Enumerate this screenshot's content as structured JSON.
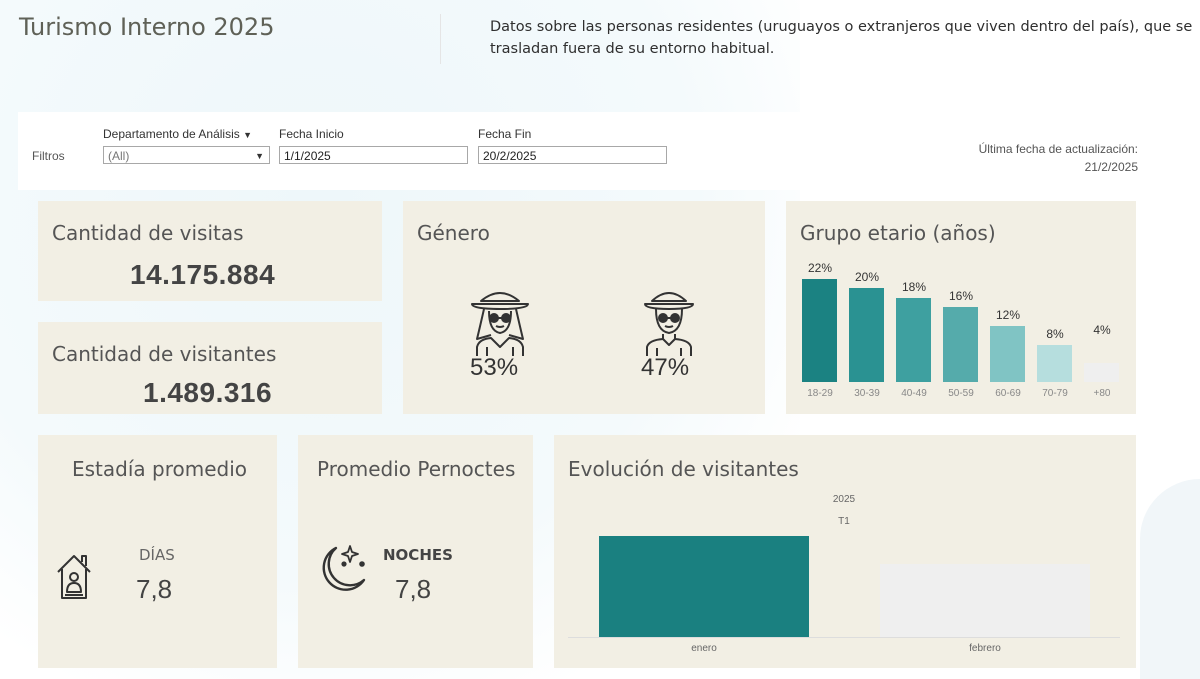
{
  "header": {
    "title": "Turismo Interno 2025",
    "description": "Datos sobre las personas residentes (uruguayos o extranjeros que viven dentro del país), que se trasladan fuera de su entorno habitual."
  },
  "filters": {
    "label": "Filtros",
    "departamento": {
      "label": "Departamento de Análisis",
      "value": "(All)"
    },
    "fecha_inicio": {
      "label": "Fecha Inicio",
      "value": "1/1/2025"
    },
    "fecha_fin": {
      "label": "Fecha Fin",
      "value": "20/2/2025"
    },
    "update_label": "Última fecha de actualización:",
    "update_date": "21/2/2025"
  },
  "visitas": {
    "title": "Cantidad de visitas",
    "value": "14.175.884"
  },
  "visitantes": {
    "title": "Cantidad de visitantes",
    "value": "1.489.316"
  },
  "genero": {
    "title": "Género",
    "female_pct": "53%",
    "male_pct": "47%",
    "female_icon": "woman-explorer-icon",
    "male_icon": "man-explorer-icon"
  },
  "estadia": {
    "title": "Estadía promedio",
    "unit": "DÍAS",
    "value": "7,8",
    "icon": "house-person-icon"
  },
  "pernoctes": {
    "title": "Promedio Pernoctes",
    "unit": "NOCHES",
    "value": "7,8",
    "icon": "moon-stars-icon"
  },
  "colors": {
    "card_bg": "#f2efe4",
    "teal_dark": "#1a8080",
    "bar_light": "#efefef"
  },
  "chart_data": [
    {
      "type": "bar",
      "title": "Grupo etario (años)",
      "categories": [
        "18-29",
        "30-39",
        "40-49",
        "50-59",
        "60-69",
        "70-79",
        "+80"
      ],
      "values": [
        22,
        20,
        18,
        16,
        12,
        8,
        4
      ],
      "labels": [
        "22%",
        "20%",
        "18%",
        "16%",
        "12%",
        "8%",
        "4%"
      ],
      "colors": [
        "#1b8282",
        "#2a9292",
        "#3ea0a0",
        "#55abab",
        "#80c4c4",
        "#b6dede",
        "#efefef"
      ],
      "ylim": [
        0,
        22
      ]
    },
    {
      "type": "bar",
      "title": "Evolución de visitantes",
      "header_year": "2025",
      "header_quarter": "T1",
      "categories": [
        "enero",
        "febrero"
      ],
      "values": [
        100,
        72
      ],
      "colors": [
        "#1a8080",
        "#efefef"
      ],
      "ylim": [
        0,
        100
      ]
    }
  ]
}
